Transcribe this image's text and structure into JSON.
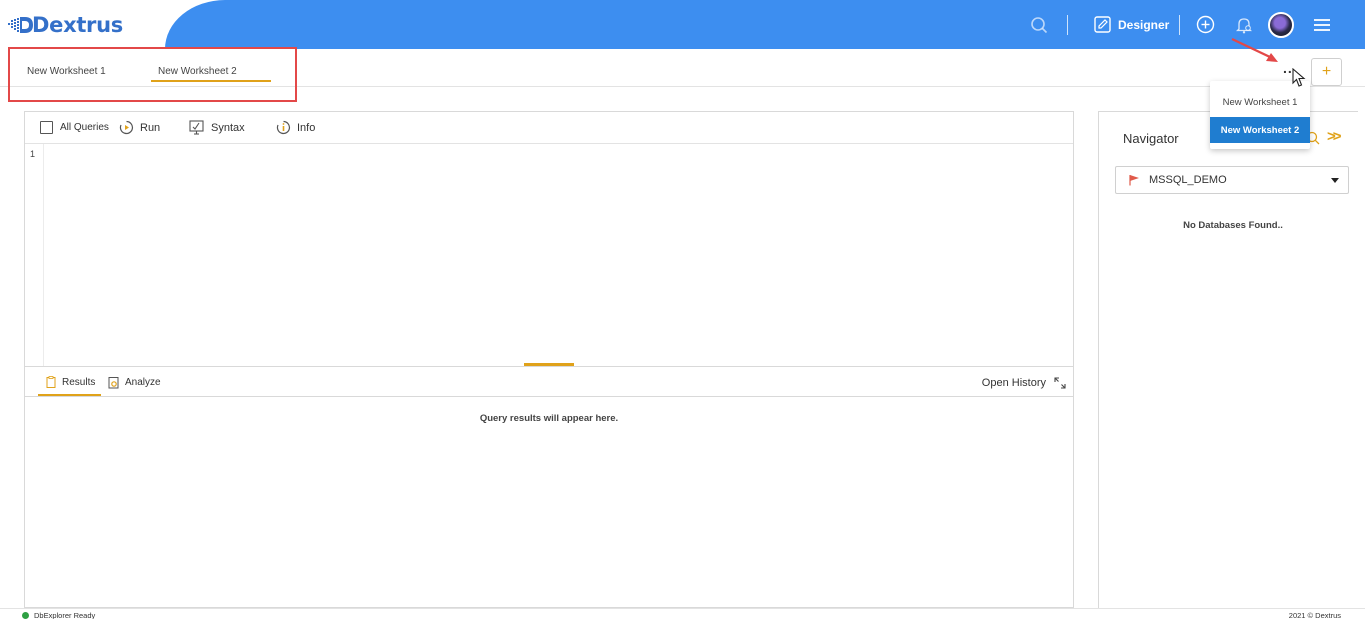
{
  "header": {
    "brand": "Dextrus",
    "designer_label": "Designer",
    "colors": {
      "bar": "#3d8ef0",
      "brand": "#3470c9",
      "accent": "#e0a21a",
      "selected": "#1f7dd0"
    },
    "icons": [
      "search-icon",
      "designer-icon",
      "add-circle-icon",
      "bell-icon",
      "avatar",
      "menu-icon"
    ]
  },
  "worksheets": {
    "tabs": [
      {
        "label": "New Worksheet 1"
      },
      {
        "label": "New Worksheet 2",
        "active": true
      }
    ],
    "more_label": "...",
    "add_label": "+",
    "menu": [
      {
        "label": "New Worksheet 1"
      },
      {
        "label": "New Worksheet 2",
        "selected": true
      }
    ]
  },
  "editor": {
    "toolbar": {
      "all_queries": "All Queries",
      "run": "Run",
      "syntax": "Syntax",
      "info": "Info"
    },
    "line_number": "1"
  },
  "results": {
    "tabs": [
      {
        "label": "Results",
        "active": true
      },
      {
        "label": "Analyze"
      }
    ],
    "open_history": "Open History",
    "empty_text": "Query results will appear here."
  },
  "navigator": {
    "title": "Navigator",
    "chevrons": ">>",
    "connection": "MSSQL_DEMO",
    "empty_text": "No Databases Found.."
  },
  "status": {
    "left": "DbExplorer Ready",
    "right": "2021 © Dextrus"
  }
}
